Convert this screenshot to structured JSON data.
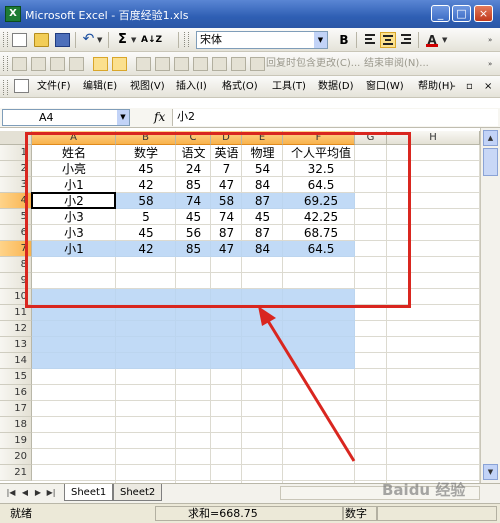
{
  "window": {
    "title": "Microsoft Excel - 百度经验1.xls",
    "app_icon": "X"
  },
  "toolbar_standard": {
    "sum_symbol": "Σ",
    "sort_label": "A↓Z",
    "font_name": "宋体",
    "bold_label": "B",
    "font_color_label": "A"
  },
  "toolbar_review": {
    "reply_text": "回复时包含更改(C)...",
    "end_review_text": "结束审阅(N)..."
  },
  "menu": [
    "文件(F)",
    "编辑(E)",
    "视图(V)",
    "插入(I)",
    "格式(O)",
    "工具(T)",
    "数据(D)",
    "窗口(W)",
    "帮助(H)"
  ],
  "formula_bar": {
    "name_box": "A4",
    "fx": "fx",
    "content": "小2"
  },
  "columns": [
    "A",
    "B",
    "C",
    "D",
    "E",
    "F",
    "G",
    "H"
  ],
  "rows": [
    "1",
    "2",
    "3",
    "4",
    "5",
    "6",
    "7",
    "8",
    "9",
    "10",
    "11",
    "12",
    "13",
    "14",
    "15",
    "16",
    "17",
    "18",
    "19",
    "20",
    "21"
  ],
  "table": {
    "headers": [
      "姓名",
      "数学",
      "语文",
      "英语",
      "物理",
      "个人平均值"
    ],
    "data": [
      [
        "小亮",
        "45",
        "24",
        "7",
        "54",
        "32.5"
      ],
      [
        "小1",
        "42",
        "85",
        "47",
        "84",
        "64.5"
      ],
      [
        "小2",
        "58",
        "74",
        "58",
        "87",
        "69.25"
      ],
      [
        "小3",
        "5",
        "45",
        "74",
        "45",
        "42.25"
      ],
      [
        "小3",
        "45",
        "56",
        "87",
        "87",
        "68.75"
      ],
      [
        "小1",
        "42",
        "85",
        "47",
        "84",
        "64.5"
      ]
    ]
  },
  "sheet_tabs": [
    "Sheet1",
    "Sheet2"
  ],
  "status": {
    "ready": "就绪",
    "sum": "求和=668.75",
    "mode": "数字"
  },
  "watermark": "Baidu 经验",
  "colors": {
    "selection": "#b6d4f5",
    "highlight_box": "#d9261f",
    "titlebar": "#2f5fb4"
  }
}
